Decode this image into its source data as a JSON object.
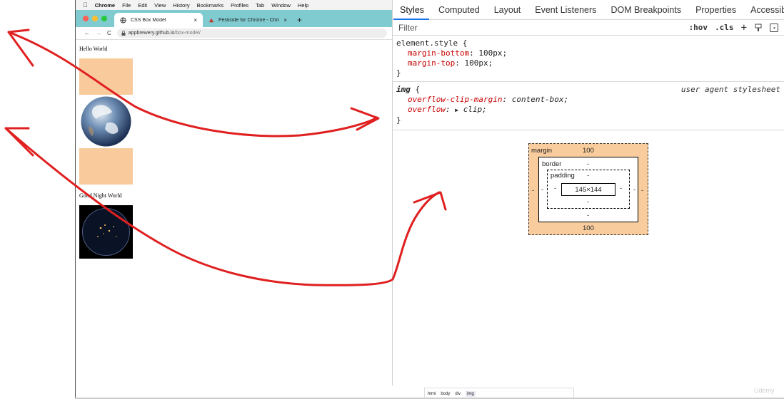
{
  "menubar": {
    "apple_icon": "apple-icon",
    "items": [
      "Chrome",
      "File",
      "Edit",
      "View",
      "History",
      "Bookmarks",
      "Profiles",
      "Tab",
      "Window",
      "Help"
    ]
  },
  "browser": {
    "tabs": [
      {
        "title": "CSS Box Model",
        "icon": "globe-icon",
        "close": "×"
      },
      {
        "title": "Pesticide for Chrome - Chrome",
        "icon": "pesticide-icon",
        "close": "×"
      }
    ],
    "new_tab": "+",
    "nav": {
      "back": "←",
      "forward": "→",
      "reload": "C"
    },
    "url": {
      "host": "appbrewery.github.io",
      "path": "/box-model/"
    },
    "colors": {
      "tab_strip": "#7fcbd0",
      "close_light": "#ff5f57",
      "min_light": "#febc2e",
      "max_light": "#28c840"
    }
  },
  "page": {
    "heading_1": "Hello World",
    "heading_2": "Good Night World",
    "highlight_color": "#f9cb9c"
  },
  "devtools": {
    "tabs": [
      "Styles",
      "Computed",
      "Layout",
      "Event Listeners",
      "DOM Breakpoints",
      "Properties",
      "Accessibility"
    ],
    "filter_placeholder": "Filter",
    "hov": ":hov",
    "cls": ".cls",
    "plus": "+",
    "rules": {
      "element_style": {
        "selector": "element.style",
        "decls": [
          {
            "prop": "margin-bottom",
            "value": "100px;"
          },
          {
            "prop": "margin-top",
            "value": "100px;"
          }
        ]
      },
      "img": {
        "selector": "img",
        "source": "user agent stylesheet",
        "decls": [
          {
            "prop": "overflow-clip-margin",
            "value": "content-box;"
          },
          {
            "prop": "overflow",
            "value": "clip;"
          }
        ]
      }
    },
    "open_brace": "{",
    "close_brace": "}"
  },
  "box_model": {
    "margin_label": "margin",
    "margin_top": "100",
    "margin_bottom": "100",
    "margin_left": "-",
    "margin_right": "-",
    "border_label": "border",
    "border_top": "-",
    "border_bottom": "-",
    "border_left": "-",
    "border_right": "-",
    "padding_label": "padding",
    "padding_top": "-",
    "padding_bottom": "-",
    "padding_left": "-",
    "padding_right": "-",
    "content_size": "145×144"
  },
  "breadcrumbs": [
    "html",
    "body",
    "div",
    "img"
  ],
  "watermark": "Udemy",
  "annotation_color": "#e02020"
}
